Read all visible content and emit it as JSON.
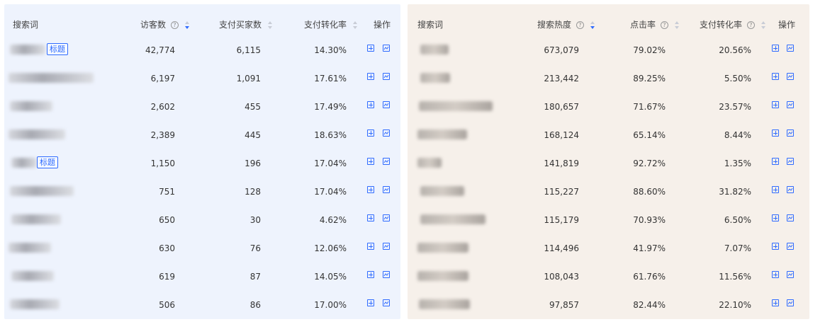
{
  "left_table": {
    "headers": {
      "keyword": "搜索词",
      "visitors": "访客数",
      "buyers": "支付买家数",
      "conversion": "支付转化率",
      "actions": "操作"
    },
    "tag_label": "标题",
    "rows": [
      {
        "visitors": "42,774",
        "buyers": "6,115",
        "conversion": "14.30%",
        "has_tag": true
      },
      {
        "visitors": "6,197",
        "buyers": "1,091",
        "conversion": "17.61%",
        "has_tag": false
      },
      {
        "visitors": "2,602",
        "buyers": "455",
        "conversion": "17.49%",
        "has_tag": false
      },
      {
        "visitors": "2,389",
        "buyers": "445",
        "conversion": "18.63%",
        "has_tag": false
      },
      {
        "visitors": "1,150",
        "buyers": "196",
        "conversion": "17.04%",
        "has_tag": true
      },
      {
        "visitors": "751",
        "buyers": "128",
        "conversion": "17.04%",
        "has_tag": false
      },
      {
        "visitors": "650",
        "buyers": "30",
        "conversion": "4.62%",
        "has_tag": false
      },
      {
        "visitors": "630",
        "buyers": "76",
        "conversion": "12.06%",
        "has_tag": false
      },
      {
        "visitors": "619",
        "buyers": "87",
        "conversion": "14.05%",
        "has_tag": false
      },
      {
        "visitors": "506",
        "buyers": "86",
        "conversion": "17.00%",
        "has_tag": false
      }
    ]
  },
  "right_table": {
    "headers": {
      "keyword": "搜索词",
      "heat": "搜索热度",
      "ctr": "点击率",
      "conversion": "支付转化率",
      "actions": "操作"
    },
    "rows": [
      {
        "heat": "673,079",
        "ctr": "79.02%",
        "conversion": "20.56%"
      },
      {
        "heat": "213,442",
        "ctr": "89.25%",
        "conversion": "5.50%"
      },
      {
        "heat": "180,657",
        "ctr": "71.67%",
        "conversion": "23.57%"
      },
      {
        "heat": "168,124",
        "ctr": "65.14%",
        "conversion": "8.44%"
      },
      {
        "heat": "141,819",
        "ctr": "92.72%",
        "conversion": "1.35%"
      },
      {
        "heat": "115,227",
        "ctr": "88.60%",
        "conversion": "31.82%"
      },
      {
        "heat": "115,179",
        "ctr": "70.93%",
        "conversion": "6.50%"
      },
      {
        "heat": "114,496",
        "ctr": "41.97%",
        "conversion": "7.07%"
      },
      {
        "heat": "108,043",
        "ctr": "61.76%",
        "conversion": "11.56%"
      },
      {
        "heat": "97,857",
        "ctr": "82.44%",
        "conversion": "22.10%"
      }
    ]
  },
  "icons": {
    "add": "add-icon",
    "trend": "trend-chart-icon",
    "help": "question-circle-icon",
    "sort": "sort-icon"
  },
  "colors": {
    "accent": "#2f6bff",
    "left_bg": "#eef3fd",
    "right_bg": "#f6f0ea"
  }
}
